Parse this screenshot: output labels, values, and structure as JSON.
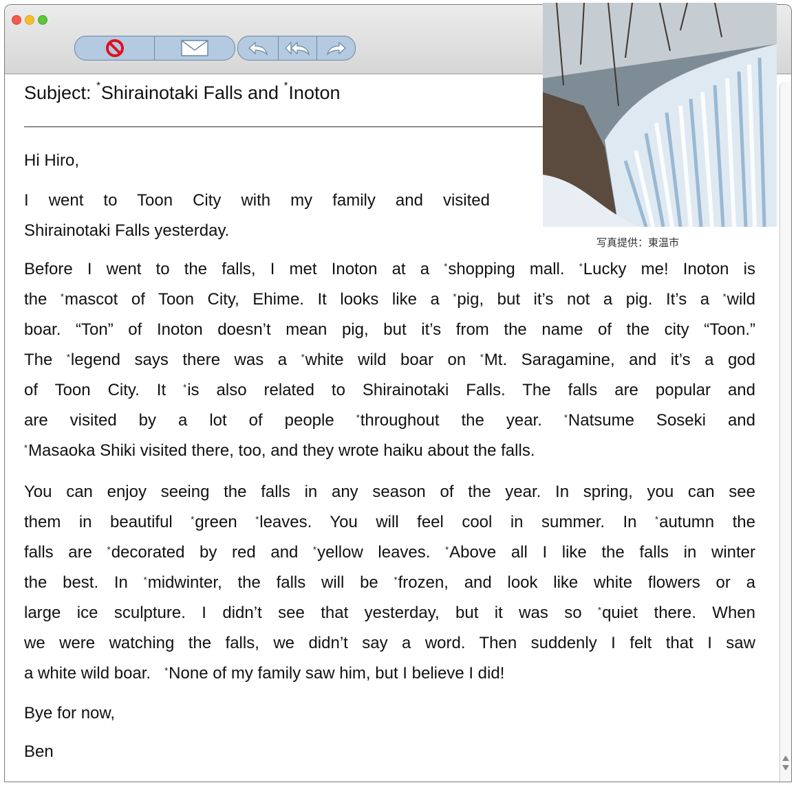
{
  "window": {
    "toolbar": {
      "icons": [
        "block-icon",
        "mail-icon",
        "reply-icon",
        "reply-all-icon",
        "forward-icon"
      ]
    }
  },
  "email": {
    "subject_label": "Subject:",
    "subject_text": "Shirainotaki Falls and",
    "subject_text2": "Inoton",
    "greeting": "Hi Hiro,",
    "intro_line1": "I went to Toon City with my family and visited",
    "intro_line2": "Shirainotaki Falls yesterday.",
    "photo_caption": "写真提供：東温市",
    "p1": [
      [
        "Before I went to the falls, I met Inoton at a ",
        "*",
        "shopping mall.   ",
        "*",
        "Lucky me!   Inoton is"
      ],
      [
        "the ",
        "*",
        "mascot of Toon City, Ehime.   It looks like a ",
        "*",
        "pig, but it’s not a pig.   It’s a ",
        "*",
        "wild"
      ],
      [
        "boar. “Ton” of Inoton doesn’t mean pig, but it’s from the name of the city “Toon.”"
      ],
      [
        "The ",
        "*",
        "legend says there was a ",
        "*",
        "white wild boar on ",
        "*",
        "Mt. Saragamine, and it’s a god"
      ],
      [
        "of Toon City.   It ",
        "*",
        "is also related to Shirainotaki Falls.   The falls are popular and"
      ],
      [
        "are visited by a lot of people ",
        "*",
        "throughout the year.   ",
        "*",
        "Natsume Soseki and"
      ],
      [
        "*",
        "Masaoka Shiki visited there, too, and they wrote haiku about the falls."
      ]
    ],
    "p2": [
      [
        "You can enjoy seeing the falls in any season of the year.   In spring, you can see"
      ],
      [
        "them in beautiful ",
        "*",
        "green ",
        "*",
        "leaves.   You will feel cool in summer.   In ",
        "*",
        "autumn the"
      ],
      [
        "falls are ",
        "*",
        "decorated by red and ",
        "*",
        "yellow leaves.   ",
        "*",
        "Above all I like the falls in winter"
      ],
      [
        "the best.   In ",
        "*",
        "midwinter, the falls will be ",
        "*",
        "frozen, and look like white flowers or a"
      ],
      [
        "large ice sculpture.   I didn’t see that yesterday, but it was so ",
        "*",
        "quiet there.   When"
      ],
      [
        "we were watching the falls, we didn’t say a word.   Then suddenly I felt that I saw"
      ],
      [
        "a white wild boar.   ",
        "*",
        "None of my family saw him, but I believe I did!"
      ]
    ],
    "closing": "Bye for now,",
    "signature": "Ben"
  }
}
